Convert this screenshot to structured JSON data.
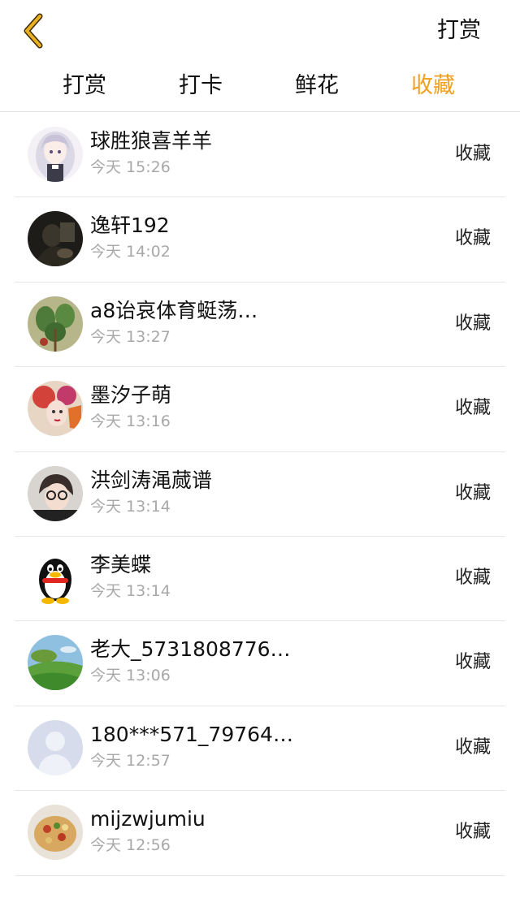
{
  "header": {
    "back_icon": "chevron-left-icon",
    "back_color": "#e8b020",
    "action_label": "打赏"
  },
  "tabs": [
    {
      "label": "打赏",
      "active": false
    },
    {
      "label": "打卡",
      "active": false
    },
    {
      "label": "鲜花",
      "active": false
    },
    {
      "label": "收藏",
      "active": true
    }
  ],
  "accent_color": "#f0a020",
  "list": {
    "items": [
      {
        "name": "球胜狼喜羊羊",
        "time": "今天 15:26",
        "action": "收藏",
        "avatar": "anime-girl-avatar"
      },
      {
        "name": "逸轩192",
        "time": "今天 14:02",
        "action": "收藏",
        "avatar": "dark-photo-avatar"
      },
      {
        "name": "a8诒哀体育蜓荡…",
        "time": "今天 13:27",
        "action": "收藏",
        "avatar": "plant-avatar"
      },
      {
        "name": "墨汐子萌",
        "time": "今天 13:16",
        "action": "收藏",
        "avatar": "opera-mask-avatar"
      },
      {
        "name": "洪剑涛渑蒇谱",
        "time": "今天 13:14",
        "action": "收藏",
        "avatar": "glasses-avatar"
      },
      {
        "name": "李美蝶",
        "time": "今天 13:14",
        "action": "收藏",
        "avatar": "penguin-avatar"
      },
      {
        "name": "老大_5731808776…",
        "time": "今天 13:06",
        "action": "收藏",
        "avatar": "landscape-avatar"
      },
      {
        "name": "180***571_79764…",
        "time": "今天 12:57",
        "action": "收藏",
        "avatar": "default-user-avatar"
      },
      {
        "name": "mijzwjumiu",
        "time": "今天 12:56",
        "action": "收藏",
        "avatar": "food-avatar"
      }
    ]
  }
}
